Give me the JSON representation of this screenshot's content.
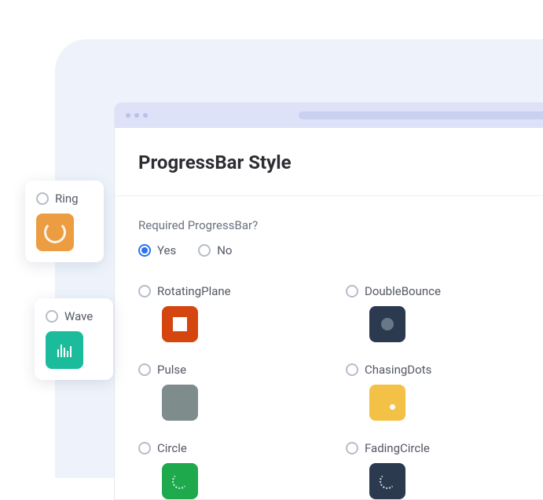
{
  "page": {
    "title": "ProgressBar Style",
    "question": "Required ProgressBar?"
  },
  "required": {
    "yes": "Yes",
    "no": "No",
    "selected": "yes"
  },
  "styles": {
    "rotatingPlane": {
      "label": "RotatingPlane",
      "color": "#d44510"
    },
    "doubleBounce": {
      "label": "DoubleBounce",
      "color": "#2b3a4f"
    },
    "pulse": {
      "label": "Pulse",
      "color": "#7f8c8c"
    },
    "chasingDots": {
      "label": "ChasingDots",
      "color": "#f3c146"
    },
    "circle": {
      "label": "Circle",
      "color": "#1ea94d"
    },
    "fadingCircle": {
      "label": "FadingCircle",
      "color": "#2b3a4f"
    }
  },
  "floatCards": {
    "ring": {
      "label": "Ring",
      "color": "#ec9c41"
    },
    "wave": {
      "label": "Wave",
      "color": "#1abc9c"
    }
  }
}
